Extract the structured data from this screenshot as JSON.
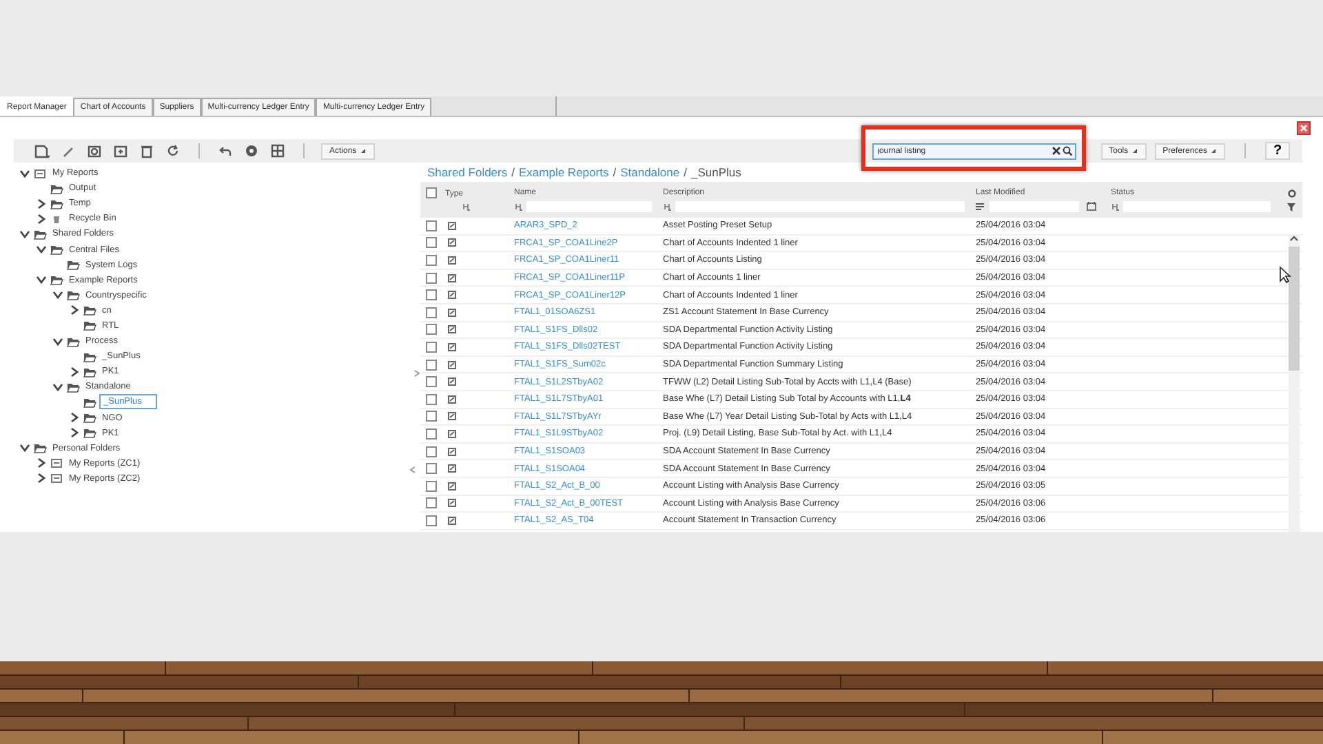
{
  "tabs": [
    {
      "label": "Report Manager",
      "selected": true
    },
    {
      "label": "Chart of Accounts",
      "selected": false
    },
    {
      "label": "Suppliers",
      "selected": false
    },
    {
      "label": "Multi-currency Ledger Entry",
      "selected": false
    },
    {
      "label": "Multi-currency Ledger Entry",
      "selected": false
    }
  ],
  "toolbar": {
    "actions": "Actions",
    "search": {
      "value": "journal listing"
    },
    "tools": "Tools",
    "preferences": "Preferences",
    "help": "?"
  },
  "tree": [
    {
      "label": "My Reports",
      "kind": "reports",
      "expandable": true,
      "expanded": true,
      "selected": false,
      "children": [
        {
          "label": "Output",
          "kind": "folder",
          "expandable": false,
          "selected": false
        },
        {
          "label": "Temp",
          "kind": "folder",
          "expandable": true,
          "expanded": false,
          "selected": false
        },
        {
          "label": "Recycle Bin",
          "kind": "bin",
          "expandable": true,
          "expanded": false,
          "selected": false
        }
      ]
    },
    {
      "label": "Shared Folders",
      "kind": "folder",
      "expandable": true,
      "expanded": true,
      "selected": false,
      "children": [
        {
          "label": "Central Files",
          "kind": "folder",
          "expandable": true,
          "expanded": true,
          "selected": false,
          "children": [
            {
              "label": "System Logs",
              "kind": "folder",
              "expandable": false,
              "selected": false
            }
          ]
        },
        {
          "label": "Example Reports",
          "kind": "folder",
          "expandable": true,
          "expanded": true,
          "selected": false,
          "children": [
            {
              "label": "Countryspecific",
              "kind": "folder",
              "expandable": true,
              "expanded": true,
              "selected": false,
              "children": [
                {
                  "label": "cn",
                  "kind": "folder",
                  "expandable": true,
                  "expanded": false,
                  "selected": false
                },
                {
                  "label": "RTL",
                  "kind": "folder",
                  "expandable": false,
                  "selected": false
                }
              ]
            },
            {
              "label": "Process",
              "kind": "folder",
              "expandable": true,
              "expanded": true,
              "selected": false,
              "children": [
                {
                  "label": "_SunPlus",
                  "kind": "folder",
                  "expandable": false,
                  "selected": false
                },
                {
                  "label": "PK1",
                  "kind": "folder",
                  "expandable": true,
                  "expanded": false,
                  "selected": false
                }
              ]
            },
            {
              "label": "Standalone",
              "kind": "folder",
              "expandable": true,
              "expanded": true,
              "selected": false,
              "children": [
                {
                  "label": "_SunPlus",
                  "kind": "folder",
                  "expandable": false,
                  "selected": true
                },
                {
                  "label": "NGO",
                  "kind": "folder",
                  "expandable": true,
                  "expanded": false,
                  "selected": false
                },
                {
                  "label": "PK1",
                  "kind": "folder",
                  "expandable": true,
                  "expanded": false,
                  "selected": false
                }
              ]
            }
          ]
        }
      ]
    },
    {
      "label": "Personal Folders",
      "kind": "folder",
      "expandable": true,
      "expanded": true,
      "selected": false,
      "children": [
        {
          "label": "My Reports (ZC1)",
          "kind": "reports",
          "expandable": true,
          "expanded": false,
          "selected": false
        },
        {
          "label": "My Reports (ZC2)",
          "kind": "reports",
          "expandable": true,
          "expanded": false,
          "selected": false
        }
      ]
    }
  ],
  "breadcrumb": {
    "items": [
      "Shared Folders",
      "Example Reports",
      "Standalone",
      "_SunPlus"
    ],
    "separator": "/"
  },
  "table": {
    "select_all_checked": false,
    "columns": [
      {
        "label": "Type",
        "kind": "icon"
      },
      {
        "label": "Name",
        "kind": "text"
      },
      {
        "label": "Description",
        "kind": "text"
      },
      {
        "label": "Last Modified",
        "kind": "date"
      },
      {
        "label": "Status",
        "kind": "text"
      }
    ],
    "rows": [
      {
        "checked": false,
        "name": "ARAR3_SPD_2",
        "description": "Asset Posting Preset Setup",
        "modified": "25/04/2016 03:04"
      },
      {
        "checked": false,
        "name": "FRCA1_SP_COA1Line2P",
        "description": "Chart of Accounts Indented 1 liner",
        "modified": "25/04/2016 03:04"
      },
      {
        "checked": false,
        "name": "FRCA1_SP_COA1Liner11",
        "description": "Chart of Accounts Listing",
        "modified": "25/04/2016 03:04"
      },
      {
        "checked": false,
        "name": "FRCA1_SP_COA1Liner11P",
        "description": "Chart of Accounts 1 liner",
        "modified": "25/04/2016 03:04"
      },
      {
        "checked": false,
        "name": "FRCA1_SP_COA1Liner12P",
        "description": "Chart of Accounts Indented 1 liner",
        "modified": "25/04/2016 03:04"
      },
      {
        "checked": false,
        "name": "FTAL1_01SOA6ZS1",
        "description": "ZS1 Account Statement In Base Currency",
        "modified": "25/04/2016 03:04"
      },
      {
        "checked": false,
        "name": "FTAL1_S1FS_Dlls02",
        "description": "SDA Departmental Function Activity Listing",
        "modified": "25/04/2016 03:04"
      },
      {
        "checked": false,
        "name": "FTAL1_S1FS_Dlls02TEST",
        "description": "SDA Departmental Function Activity Listing",
        "modified": "25/04/2016 03:04"
      },
      {
        "checked": false,
        "name": "FTAL1_S1FS_Sum02c",
        "description": "SDA Departmental Function Summary Listing",
        "modified": "25/04/2016 03:04"
      },
      {
        "checked": false,
        "name": "FTAL1_S1L2STbyA02",
        "description": "TFWW (L2) Detail Listing Sub-Total by Accts with L1,L4 (Base)",
        "modified": "25/04/2016 03:04"
      },
      {
        "checked": false,
        "name": "FTAL1_S1L7STbyA01",
        "description": "Base Whe (L7) Detail Listing Sub Total by Accounts with L1,**L4**",
        "modified": "25/04/2016 03:04"
      },
      {
        "checked": false,
        "name": "FTAL1_S1L7STbyAYr",
        "description": "Base Whe (L7) Year Detail Listing Sub-Total by Acts with L1,L4",
        "modified": "25/04/2016 03:04"
      },
      {
        "checked": false,
        "name": "FTAL1_S1L9STbyA02",
        "description": "Proj. (L9) Detail Listing, Base Sub-Total by Act. with L1,L4",
        "modified": "25/04/2016 03:04"
      },
      {
        "checked": false,
        "name": "FTAL1_S1SOA03",
        "description": "SDA Account Statement In Base Currency",
        "modified": "25/04/2016 03:04"
      },
      {
        "checked": false,
        "name": "FTAL1_S1SOA04",
        "description": "SDA Account Statement In Base Currency",
        "modified": "25/04/2016 03:04"
      },
      {
        "checked": false,
        "name": "FTAL1_S2_Act_B_00",
        "description": "Account Listing with Analysis Base Currency",
        "modified": "25/04/2016 03:05"
      },
      {
        "checked": false,
        "name": "FTAL1_S2_Act_B_00TEST",
        "description": "Account Listing with Analysis Base Currency",
        "modified": "25/04/2016 03:06"
      },
      {
        "checked": false,
        "name": "FTAL1_S2_AS_T04",
        "description": "Account Statement In Transaction Currency",
        "modified": "25/04/2016 03:06"
      }
    ]
  }
}
